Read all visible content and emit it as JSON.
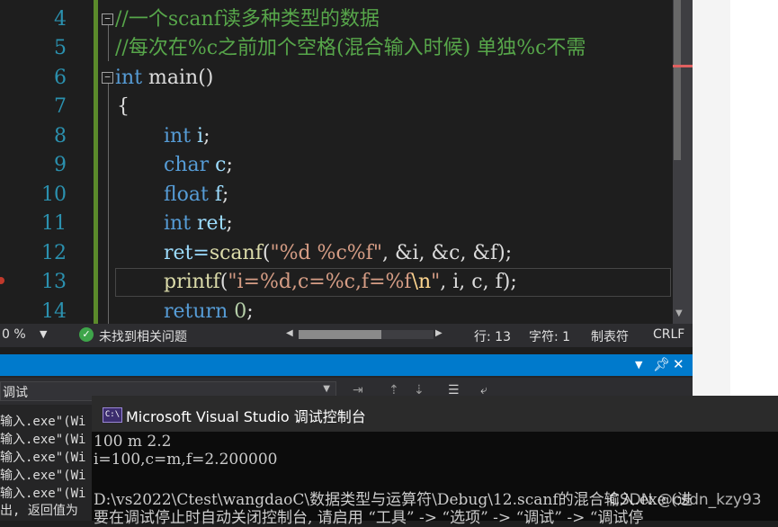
{
  "editor": {
    "lines": [
      {
        "num": "4",
        "text": "//一个scanf读多种类型的数据"
      },
      {
        "num": "5",
        "text": "//每次在%c之前加个空格(混合输入时候) 单独%c不需"
      },
      {
        "num": "6",
        "kw": "int",
        "rest": " main()"
      },
      {
        "num": "7",
        "text": "{"
      },
      {
        "num": "8",
        "kw": "int",
        "var": " i",
        "rest": ";"
      },
      {
        "num": "9",
        "kw": "char",
        "var": " c",
        "rest": ";"
      },
      {
        "num": "10",
        "kw": "float",
        "var": " f",
        "rest": ";"
      },
      {
        "num": "11",
        "kw": "int",
        "var": " ret",
        "rest": ";"
      },
      {
        "num": "12",
        "p1": "ret=",
        "fn": "scanf",
        "p2": "(",
        "str": "\"%d %c%f\"",
        "p3": ", &i, &c, &f);"
      },
      {
        "num": "13",
        "fn": "printf",
        "p2": "(",
        "str": "\"i=%d,c=%c,f=%f",
        "esc": "\\n",
        "str2": "\"",
        "p3": ", i, c, f);"
      },
      {
        "num": "14",
        "kw": "return",
        "num_val": " 0",
        "rest": ";"
      }
    ]
  },
  "statusbar": {
    "zoom": "0 %",
    "issues": "未找到相关问题",
    "line": "行: 13",
    "char": "字符: 1",
    "tabs": "制表符",
    "eol": "CRLF"
  },
  "output": {
    "source_label": "调试",
    "lines": [
      "输入.exe\"(Wi",
      "输入.exe\"(Wi",
      "输入.exe\"(Wi",
      "输入.exe\"(Wi",
      "输入.exe\"(Wi",
      "出, 返回值为"
    ]
  },
  "console": {
    "title": "Microsoft Visual Studio 调试控制台",
    "icon_text": "C:\\",
    "lines": [
      "100 m 2.2",
      "i=100,c=m,f=2.200000",
      "",
      "D:\\vs2022\\Ctest\\wangdaoC\\数据类型与运算符\\Debug\\12.scanf的混合输入.exe (进",
      "要在调试停止时自动关闭控制台, 请启用 “工具” -> “选项” -> “调试” -> “调试停"
    ],
    "watermark": "CSDN @csdn_kzy93"
  },
  "colors": {
    "keyword": "#569cd6",
    "comment": "#57a64a",
    "string": "#d69d85",
    "line_number": "#2b91af",
    "panel_title": "#007acc"
  }
}
